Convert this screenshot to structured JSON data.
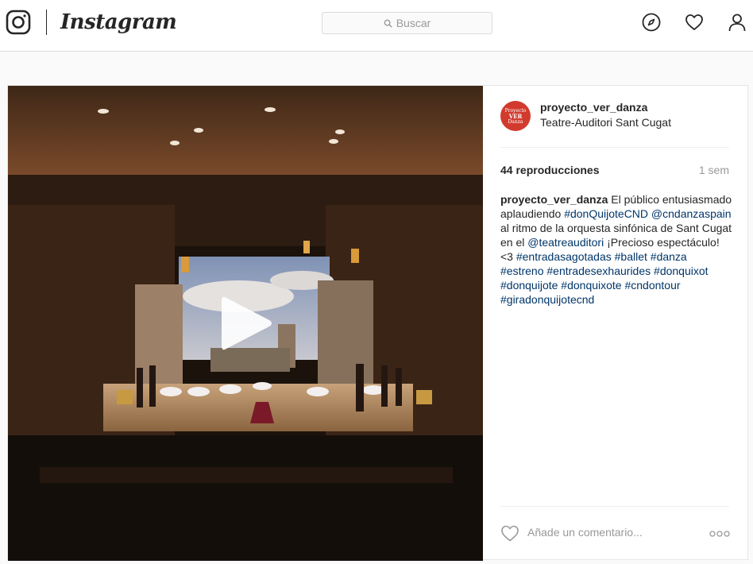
{
  "header": {
    "brand": "Instagram",
    "search_placeholder": "Buscar",
    "icons": [
      "camera-icon",
      "search-icon",
      "compass-icon",
      "heart-icon",
      "profile-icon"
    ]
  },
  "post": {
    "username": "proyecto_ver_danza",
    "location": "Teatre-Auditori Sant Cugat",
    "avatar_text": [
      "Proyecto",
      "VER",
      "Danza"
    ],
    "views": "44 reproducciones",
    "time_ago": "1 sem",
    "caption": {
      "username": "proyecto_ver_danza",
      "t1": " El público entusiasmado aplaudiendo ",
      "h1": "#donQuijoteCND",
      "m1": "@cndanzaspain",
      "t2": " al ritmo de la orquesta sinfónica de Sant Cugat en el ",
      "m2": "@teatreauditori",
      "t3": " ¡Precioso espectáculo! <3 ",
      "h2": "#entradasagotadas",
      "h3": "#ballet",
      "h4": "#danza",
      "h5": "#estreno",
      "h6": "#entradesexhaurides",
      "h7": "#donquixot",
      "h8": "#donquijote",
      "h9": "#donquixote",
      "h10": "#cndontour",
      "h11": "#giradonquijotecnd"
    },
    "comment_placeholder": "Añade un comentario...",
    "media_icons": [
      "play-icon"
    ],
    "colors": {
      "link": "#003569",
      "muted": "#999999",
      "avatar": "#d23a2e"
    }
  }
}
